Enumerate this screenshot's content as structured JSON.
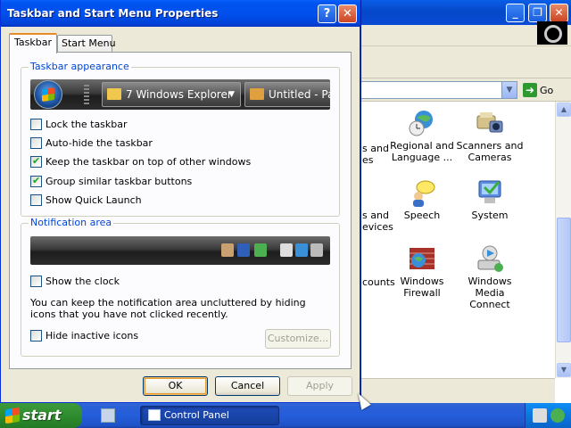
{
  "dialog": {
    "title": "Taskbar and Start Menu Properties",
    "tabs": [
      {
        "label": "Taskbar",
        "active": true
      },
      {
        "label": "Start Menu",
        "active": false
      }
    ],
    "taskbar_group": {
      "label": "Taskbar appearance",
      "preview_buttons": [
        "7 Windows Explorer",
        "Untitled - Pa"
      ],
      "options": [
        {
          "label": "Lock the taskbar",
          "checked": false
        },
        {
          "label": "Auto-hide the taskbar",
          "checked": false
        },
        {
          "label": "Keep the taskbar on top of other windows",
          "checked": true
        },
        {
          "label": "Group similar taskbar buttons",
          "checked": true
        },
        {
          "label": "Show Quick Launch",
          "checked": false
        }
      ]
    },
    "notification_group": {
      "label": "Notification area",
      "show_clock": {
        "label": "Show the clock",
        "checked": false
      },
      "help_text": "You can keep the notification area uncluttered by hiding icons that you have not clicked recently.",
      "hide_inactive": {
        "label": "Hide inactive icons",
        "checked": false
      },
      "customize_label": "Customize..."
    },
    "buttons": {
      "ok": "OK",
      "cancel": "Cancel",
      "apply": "Apply"
    }
  },
  "background_window": {
    "go_label": "Go",
    "items": [
      {
        "label": "Regional and Language ...",
        "icon": "globe-clock-icon"
      },
      {
        "label": "Scanners and Cameras",
        "icon": "scanner-camera-icon"
      },
      {
        "label": "Speech",
        "icon": "speech-icon"
      },
      {
        "label": "System",
        "icon": "system-icon"
      },
      {
        "label": "Windows Firewall",
        "icon": "firewall-icon"
      },
      {
        "label": "Windows Media Connect",
        "icon": "media-connect-icon"
      }
    ],
    "partial_labels": [
      "s and",
      "es",
      "s and",
      "evices",
      "counts"
    ]
  },
  "taskbar": {
    "start_label": "start",
    "task_button": "Control Panel"
  },
  "colors": {
    "xp_blue": "#0053ee",
    "start_green": "#2f8c2f",
    "group_label": "#0046d5"
  }
}
